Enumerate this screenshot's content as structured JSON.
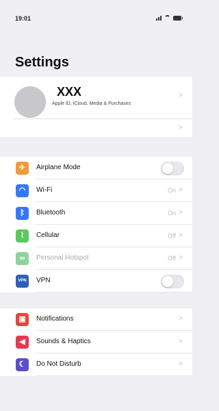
{
  "status": {
    "time": "19:01"
  },
  "title": "Settings",
  "profile": {
    "name": "XXX",
    "subtitle": "Apple ID, iCloud, Media & Purchases"
  },
  "connectivity": [
    {
      "label": "Airplane Mode",
      "value": "",
      "control": "toggle",
      "color": "#f09a37",
      "icon": "airplane-icon",
      "glyph": "✈",
      "enabled": true
    },
    {
      "label": "Wi-Fi",
      "value": "On",
      "control": "chevron",
      "color": "#3478f6",
      "icon": "wifi-icon",
      "glyph": "◠",
      "enabled": true
    },
    {
      "label": "Bluetooth",
      "value": "On",
      "control": "chevron",
      "color": "#3478f6",
      "icon": "bluetooth-icon",
      "glyph": "ᛒ",
      "enabled": true
    },
    {
      "label": "Cellular",
      "value": "Off",
      "control": "chevron",
      "color": "#5ac85a",
      "icon": "cellular-icon",
      "glyph": "⌇",
      "enabled": true
    },
    {
      "label": "Personal Hotspot",
      "value": "Off",
      "control": "chevron",
      "color": "#8fd49a",
      "icon": "hotspot-icon",
      "glyph": "∞",
      "enabled": false
    },
    {
      "label": "VPN",
      "value": "",
      "control": "toggle",
      "color": "#2f5fb8",
      "icon": "vpn-icon",
      "glyph": "VPN",
      "enabled": true
    }
  ],
  "general": [
    {
      "label": "Notifications",
      "color": "#e9453a",
      "icon": "notifications-icon",
      "glyph": "▣"
    },
    {
      "label": "Sounds & Haptics",
      "color": "#e8384f",
      "icon": "sounds-icon",
      "glyph": "◀"
    },
    {
      "label": "Do Not Disturb",
      "color": "#5b4fc9",
      "icon": "moon-icon",
      "glyph": "☾"
    }
  ]
}
